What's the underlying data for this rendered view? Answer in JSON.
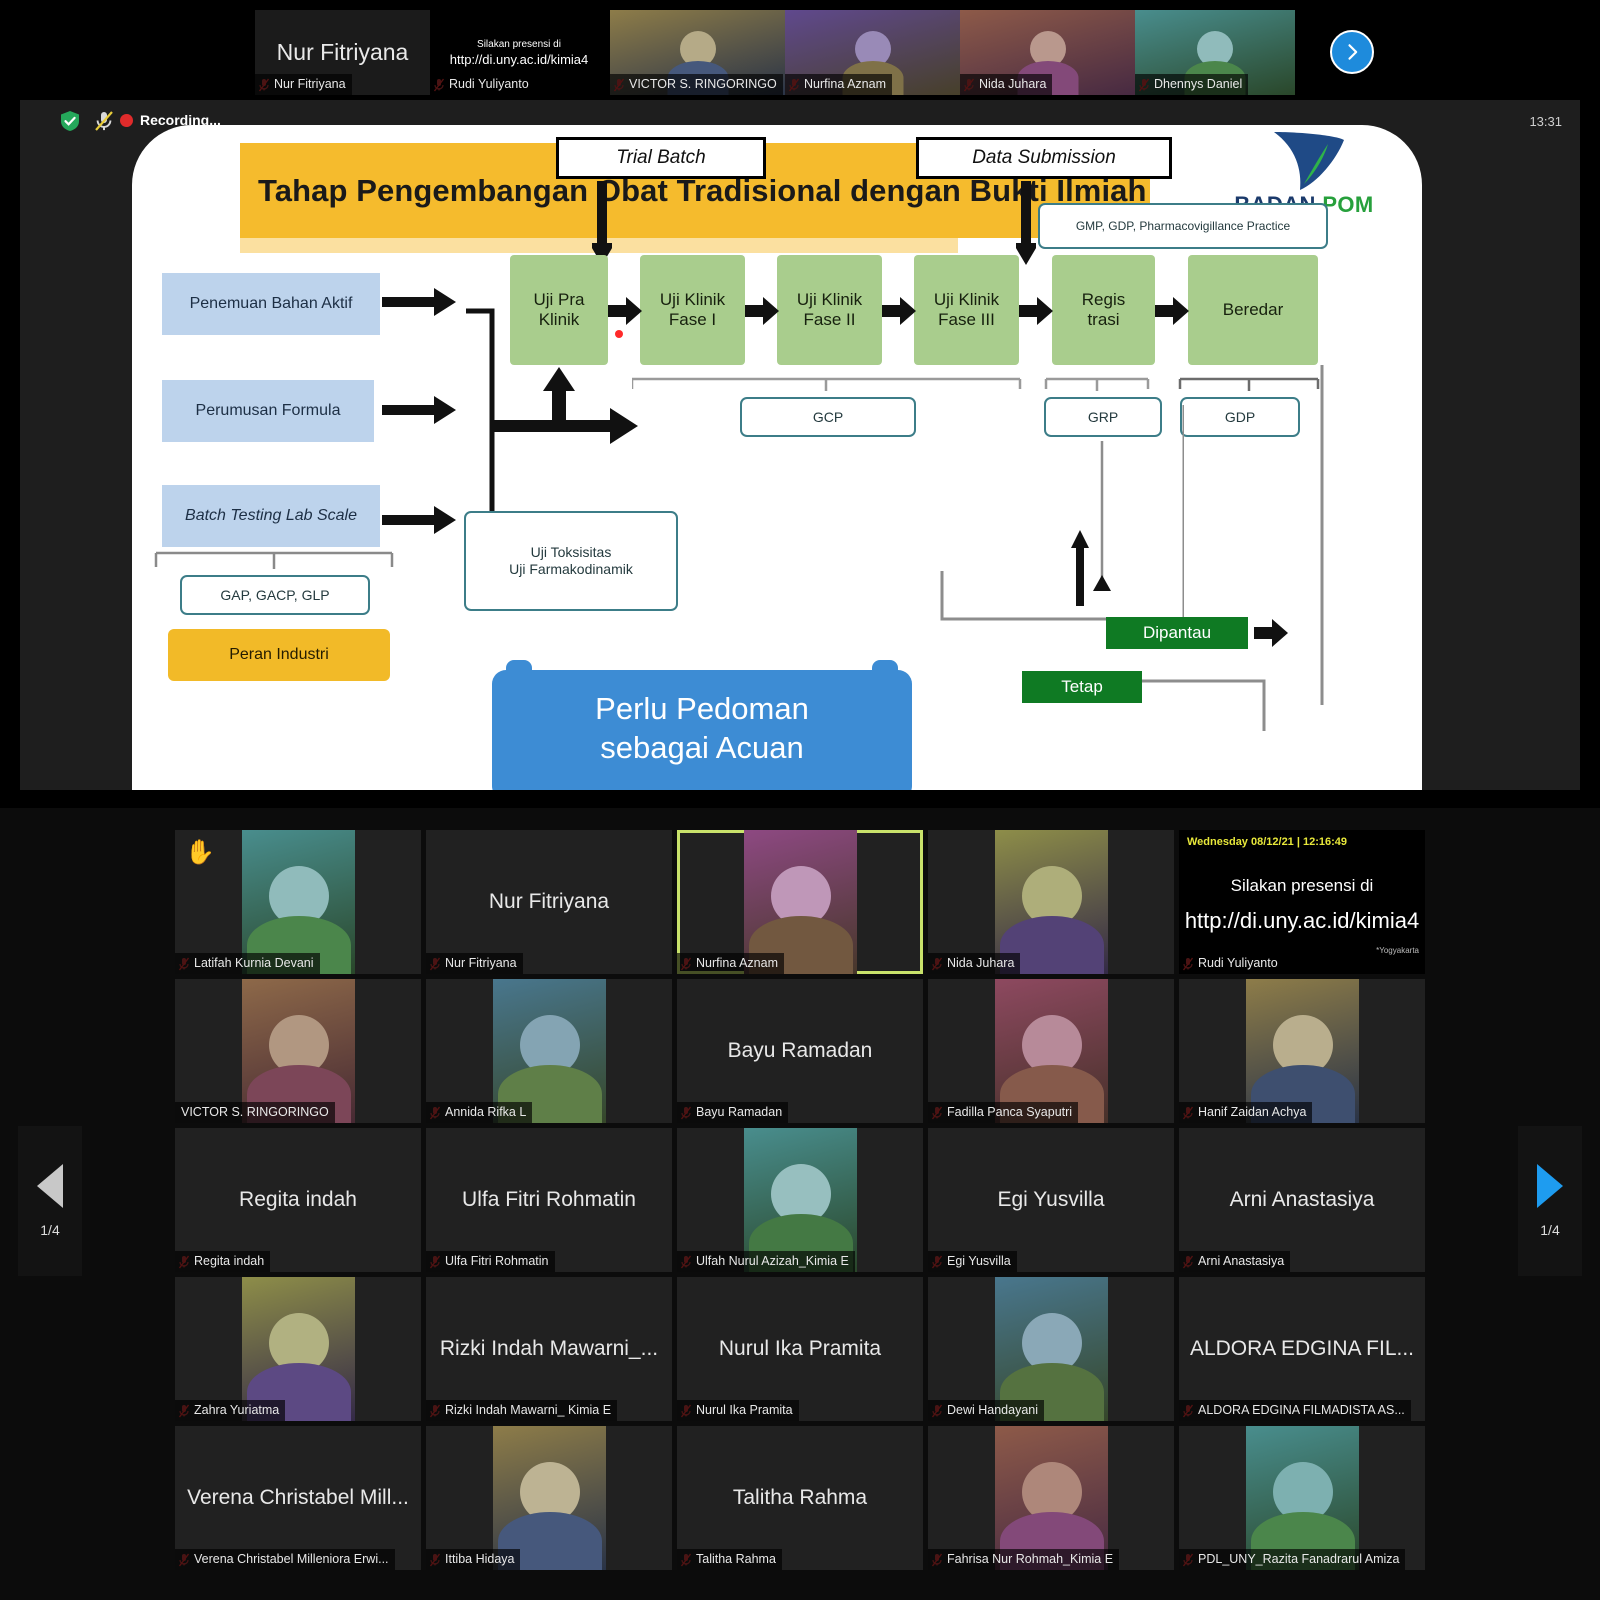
{
  "meeting": {
    "recording_label": "Recording...",
    "clock": "13:31",
    "shield_icon": "shield-check-icon",
    "mic_icon": "microphone-muted-icon",
    "record_icon": "record-dot-icon"
  },
  "filmstrip": {
    "next_icon": "chevron-right-icon",
    "tiles": [
      {
        "name": "Nur Fitriyana",
        "display": "Nur Fitriyana",
        "kind": "name-only"
      },
      {
        "name": "Rudi Yuliyanto",
        "kind": "presensi",
        "line1": "Silakan presensi di",
        "line2": "http://di.uny.ac.id/kimia4"
      },
      {
        "name": "VICTOR S. RINGORINGO",
        "kind": "video",
        "speaking": true
      },
      {
        "name": "Nurfina Aznam",
        "kind": "video"
      },
      {
        "name": "Nida Juhara",
        "kind": "video"
      },
      {
        "name": "Dhennys Daniel",
        "kind": "video"
      }
    ]
  },
  "slide": {
    "title": "Tahap Pengembangan Obat Tradisional dengan Bukti Ilmiah",
    "logo_text_a": "BADAN",
    "logo_text_b": " POM",
    "inputs": [
      "Penemuan Bahan Aktif",
      "Perumusan Formula",
      "Batch Testing Lab Scale"
    ],
    "stage_labels": {
      "trial_batch": "Trial Batch",
      "data_submission": "Data Submission"
    },
    "flow": [
      "Uji Pra\nKlinik",
      "Uji Klinik\nFase I",
      "Uji Klinik\nFase II",
      "Uji Klinik\nFase III",
      "Regis\ntrasi",
      "Beredar"
    ],
    "flow_lines": [
      [
        "Uji Pra",
        "Klinik"
      ],
      [
        "Uji Klinik",
        "Fase I"
      ],
      [
        "Uji Klinik",
        "Fase II"
      ],
      [
        "Uji Klinik",
        "Fase III"
      ],
      [
        "Regis",
        "trasi"
      ],
      [
        "Beredar",
        ""
      ]
    ],
    "gmp_note": "GMP, GDP, Pharmacovigillance Practice",
    "standards": {
      "gcp": "GCP",
      "grp": "GRP",
      "gdp": "GDP",
      "gap": "GAP, GACP, GLP"
    },
    "toxicity_box": [
      "Uji Toksisitas",
      "Uji Farmakodinamik"
    ],
    "peran_industri": "Peran Industri",
    "perlu_pedoman": [
      "Perlu Pedoman",
      "sebagai Acuan"
    ],
    "monitor": {
      "dipantau": "Dipantau",
      "tetap": "Tetap"
    }
  },
  "gallery": {
    "prev_page": "1/4",
    "next_page": "1/4",
    "prev_icon": "triangle-left-icon",
    "next_icon": "triangle-right-icon",
    "hand_icon": "raised-hand-icon",
    "mute_icon": "microphone-muted-icon",
    "presensi": {
      "timestamp": "Wednesday 08/12/21 | 12:16:49",
      "line1": "Silakan presensi di",
      "line2": "http://di.uny.ac.id/kimia4",
      "line3": "*Yogyakarta"
    },
    "tiles": [
      {
        "name": "Latifah Kurnia Devani",
        "kind": "video",
        "hand": true
      },
      {
        "name": "Nur Fitriyana",
        "kind": "name-only",
        "display": "Nur Fitriyana"
      },
      {
        "name": "Nurfina Aznam",
        "kind": "video",
        "speaking": true
      },
      {
        "name": "Nida Juhara",
        "kind": "video"
      },
      {
        "name": "Rudi Yuliyanto",
        "kind": "presensi"
      },
      {
        "name": "VICTOR S. RINGORINGO",
        "kind": "video",
        "no_mute": true
      },
      {
        "name": "Annida Rifka L",
        "kind": "video"
      },
      {
        "name": "Bayu Ramadan",
        "kind": "name-only",
        "display": "Bayu Ramadan"
      },
      {
        "name": "Fadilla Panca Syaputri",
        "kind": "video"
      },
      {
        "name": "Hanif Zaidan Achya",
        "kind": "video"
      },
      {
        "name": "Regita indah",
        "kind": "name-only",
        "display": "Regita indah"
      },
      {
        "name": "Ulfa Fitri Rohmatin",
        "kind": "name-only",
        "display": "Ulfa Fitri Rohmatin"
      },
      {
        "name": "Ulfah Nurul Azizah_Kimia E",
        "kind": "video"
      },
      {
        "name": "Egi Yusvilla",
        "kind": "name-only",
        "display": "Egi Yusvilla"
      },
      {
        "name": "Arni Anastasiya",
        "kind": "name-only",
        "display": "Arni Anastasiya"
      },
      {
        "name": "Zahra Yuriatma",
        "kind": "video"
      },
      {
        "name": "Rizki Indah Mawarni_ Kimia E",
        "kind": "name-only",
        "display": "Rizki Indah Mawarni_..."
      },
      {
        "name": "Nurul Ika Pramita",
        "kind": "name-only",
        "display": "Nurul Ika Pramita"
      },
      {
        "name": "Dewi Handayani",
        "kind": "video"
      },
      {
        "name": "ALDORA EDGINA FILMADISTA AS...",
        "kind": "name-only",
        "display": "ALDORA EDGINA FIL..."
      },
      {
        "name": "Verena Christabel Milleniora Erwi...",
        "kind": "name-only",
        "display": "Verena Christabel Mill..."
      },
      {
        "name": "Ittiba Hidaya",
        "kind": "video"
      },
      {
        "name": "Talitha Rahma",
        "kind": "name-only",
        "display": "Talitha Rahma"
      },
      {
        "name": "Fahrisa Nur Rohmah_Kimia E",
        "kind": "video"
      },
      {
        "name": "PDL_UNY_Razita Fanadrarul Amiza",
        "kind": "video"
      }
    ]
  },
  "colors": {
    "title_band": "#f5bb2d",
    "blue_box": "#bdd3ec",
    "green_box": "#a9cd8d",
    "dark_green": "#0f7a23",
    "teal_border": "#3c7d88",
    "accent_blue": "#3d8cd4",
    "speaking_outline": "#c9e26b",
    "record_red": "#e02b2b"
  }
}
